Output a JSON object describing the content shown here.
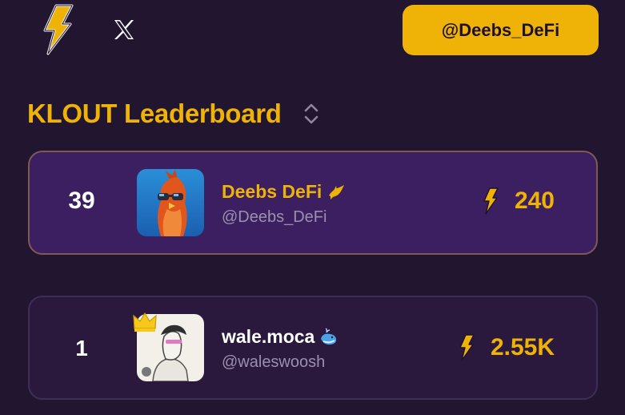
{
  "header": {
    "logo_icon": "lightning-bolt-icon",
    "x_icon": "x-logo-icon",
    "handle_button_label": "@Deebs_DeFi"
  },
  "leaderboard": {
    "title": "KLOUT Leaderboard",
    "sort_icon": "sort-toggle-icon",
    "entries": [
      {
        "rank": "39",
        "name": "Deebs DeFi",
        "name_badge_icon": "bird-badge-icon",
        "handle": "@Deebs_DeFi",
        "score_icon": "lightning-bolt-icon",
        "score": "240",
        "highlighted": true
      },
      {
        "rank": "1",
        "name": "wale.moca",
        "name_badge_icon": "whale-emoji-icon",
        "handle": "@waleswoosh",
        "score_icon": "lightning-bolt-icon",
        "score": "2.55K",
        "crown_icon": "crown-icon",
        "highlighted": false
      }
    ]
  },
  "colors": {
    "background": "#211530",
    "accent": "#eeb306",
    "highlight_card": "#3c1f60",
    "card": "#2a193d",
    "muted_text": "#9b90ac"
  }
}
